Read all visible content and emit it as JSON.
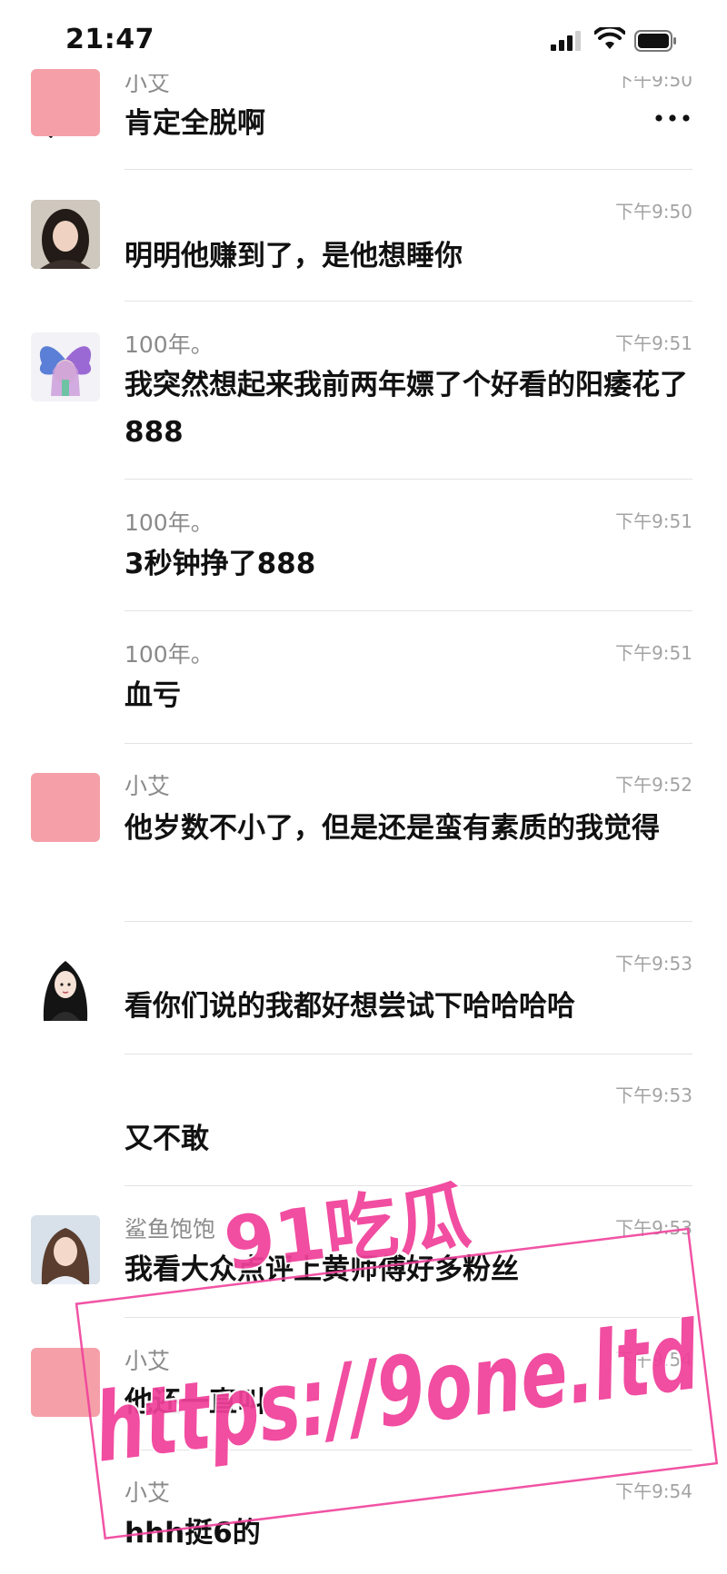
{
  "status_bar": {
    "time": "21:47",
    "icons": [
      "signal-icon",
      "wifi-icon",
      "battery-icon"
    ]
  },
  "nav": {
    "back_icon": "chevron-left-icon",
    "more_icon": "more-dots-icon"
  },
  "messages": [
    {
      "sender": "小艾",
      "time": "下午9:50",
      "text": "肯定全脱啊",
      "avatar": "pink-square"
    },
    {
      "sender": "",
      "time": "下午9:50",
      "text": "明明他赚到了，是他想睡你",
      "avatar": "woman-photo"
    },
    {
      "sender": "100年。",
      "time": "下午9:51",
      "text": "我突然想起来我前两年嫖了个好看的阳痿花了888",
      "avatar": "butterfly-girl"
    },
    {
      "sender": "100年。",
      "time": "下午9:51",
      "text": "3秒钟挣了888",
      "avatar": ""
    },
    {
      "sender": "100年。",
      "time": "下午9:51",
      "text": "血亏",
      "avatar": ""
    },
    {
      "sender": "小艾",
      "time": "下午9:52",
      "text": "他岁数不小了，但是还是蛮有素质的我觉得",
      "avatar": "pink-square"
    },
    {
      "sender": "",
      "time": "下午9:53",
      "text": "看你们说的我都好想尝试下哈哈哈哈",
      "avatar": "illustrated-girl"
    },
    {
      "sender": "",
      "time": "下午9:53",
      "text": "又不敢",
      "avatar": ""
    },
    {
      "sender": "鲨鱼饱饱",
      "time": "下午9:53",
      "text": "我看大众点评上黄师傅好多粉丝",
      "avatar": "woman-selfie"
    },
    {
      "sender": "小艾",
      "time": "下午9:54",
      "text": "他还一直叫",
      "avatar": "pink-square"
    },
    {
      "sender": "小艾",
      "time": "下午9:54",
      "text": "hhh挺6的",
      "avatar": ""
    }
  ],
  "watermark": {
    "brand": "91吃瓜",
    "url": "https://9one.ltd",
    "color": "#f0409a"
  }
}
